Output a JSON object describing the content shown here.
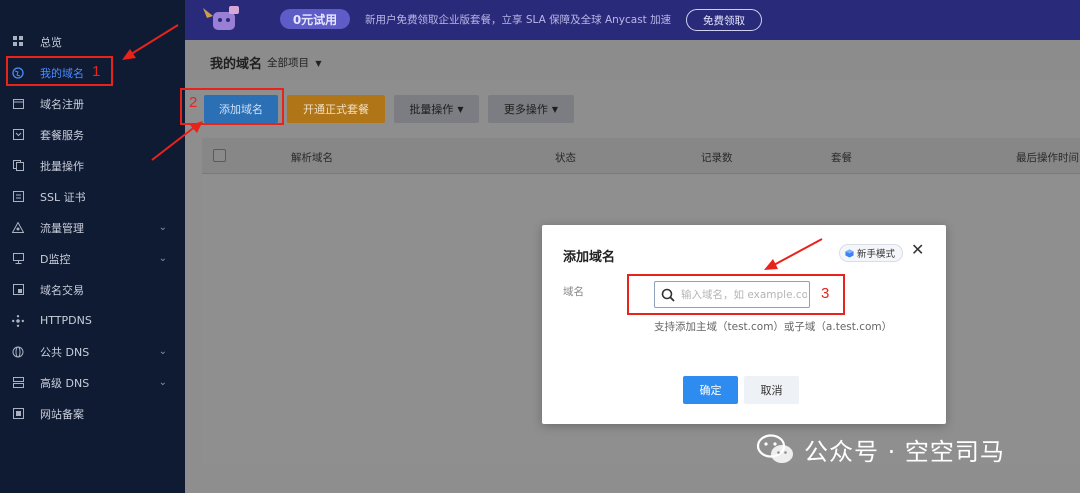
{
  "sidebar": {
    "items": [
      {
        "label": "总览",
        "icon": "grid-icon"
      },
      {
        "label": "我的域名",
        "icon": "globe-icon",
        "active": true
      },
      {
        "label": "域名注册",
        "icon": "calendar-icon"
      },
      {
        "label": "套餐服务",
        "icon": "package-icon"
      },
      {
        "label": "批量操作",
        "icon": "copy-icon"
      },
      {
        "label": "SSL 证书",
        "icon": "certificate-icon"
      },
      {
        "label": "流量管理",
        "icon": "traffic-icon",
        "expandable": true
      },
      {
        "label": "D监控",
        "icon": "monitor-icon",
        "expandable": true
      },
      {
        "label": "域名交易",
        "icon": "trade-icon"
      },
      {
        "label": "HTTPDNS",
        "icon": "network-icon"
      },
      {
        "label": "公共 DNS",
        "icon": "globe-settings-icon",
        "expandable": true
      },
      {
        "label": "高级 DNS",
        "icon": "server-icon",
        "expandable": true
      },
      {
        "label": "网站备案",
        "icon": "record-icon"
      }
    ]
  },
  "promo": {
    "pill": "0元试用",
    "text": "新用户免费领取企业版套餐，立享 SLA 保障及全球 Anycast 加速",
    "button": "免费领取"
  },
  "header": {
    "title": "我的域名",
    "filter": "全部项目"
  },
  "toolbar": {
    "add": "添加域名",
    "open": "开通正式套餐",
    "batch": "批量操作",
    "more": "更多操作"
  },
  "table": {
    "columns": [
      "解析域名",
      "状态",
      "记录数",
      "套餐",
      "最后操作时间"
    ]
  },
  "dialog": {
    "title": "添加域名",
    "badge": "新手模式",
    "close_icon": "close-icon",
    "field_label": "域名",
    "placeholder": "输入域名，如 example.com",
    "help": "支持添加主域（test.com）或子域（a.test.com）",
    "ok": "确定",
    "cancel": "取消"
  },
  "annotations": {
    "step1": "1",
    "step2": "2",
    "step3": "3"
  },
  "watermark": "公众号 · 空空司马",
  "colors": {
    "sidebar_bg": "#0f1a33",
    "active": "#4a8cff",
    "primary": "#2e8cf0",
    "annotation": "#e8231c"
  }
}
